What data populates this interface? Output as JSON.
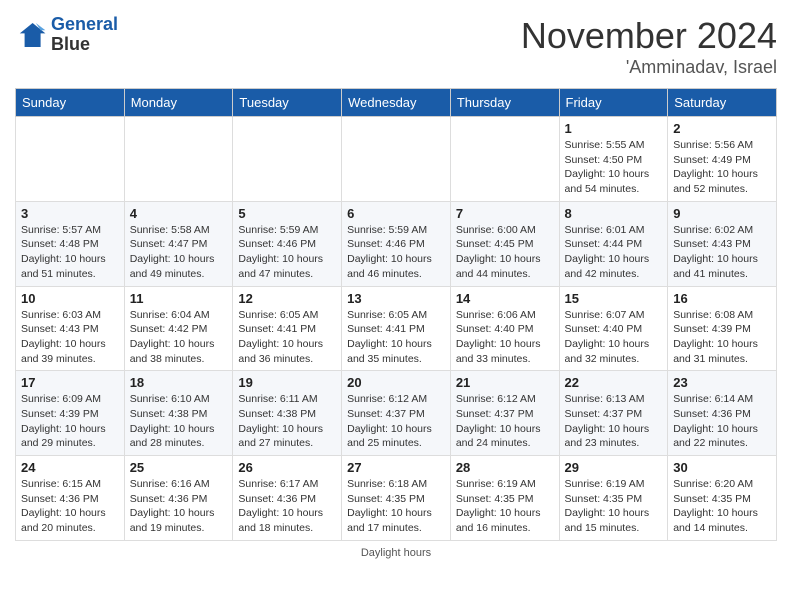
{
  "logo": {
    "line1": "General",
    "line2": "Blue"
  },
  "header": {
    "month": "November 2024",
    "location": "'Amminadav, Israel"
  },
  "weekdays": [
    "Sunday",
    "Monday",
    "Tuesday",
    "Wednesday",
    "Thursday",
    "Friday",
    "Saturday"
  ],
  "footer": {
    "daylight_label": "Daylight hours"
  },
  "weeks": [
    [
      {
        "day": "",
        "sunrise": "",
        "sunset": "",
        "daylight": ""
      },
      {
        "day": "",
        "sunrise": "",
        "sunset": "",
        "daylight": ""
      },
      {
        "day": "",
        "sunrise": "",
        "sunset": "",
        "daylight": ""
      },
      {
        "day": "",
        "sunrise": "",
        "sunset": "",
        "daylight": ""
      },
      {
        "day": "",
        "sunrise": "",
        "sunset": "",
        "daylight": ""
      },
      {
        "day": "1",
        "sunrise": "Sunrise: 5:55 AM",
        "sunset": "Sunset: 4:50 PM",
        "daylight": "Daylight: 10 hours and 54 minutes."
      },
      {
        "day": "2",
        "sunrise": "Sunrise: 5:56 AM",
        "sunset": "Sunset: 4:49 PM",
        "daylight": "Daylight: 10 hours and 52 minutes."
      }
    ],
    [
      {
        "day": "3",
        "sunrise": "Sunrise: 5:57 AM",
        "sunset": "Sunset: 4:48 PM",
        "daylight": "Daylight: 10 hours and 51 minutes."
      },
      {
        "day": "4",
        "sunrise": "Sunrise: 5:58 AM",
        "sunset": "Sunset: 4:47 PM",
        "daylight": "Daylight: 10 hours and 49 minutes."
      },
      {
        "day": "5",
        "sunrise": "Sunrise: 5:59 AM",
        "sunset": "Sunset: 4:46 PM",
        "daylight": "Daylight: 10 hours and 47 minutes."
      },
      {
        "day": "6",
        "sunrise": "Sunrise: 5:59 AM",
        "sunset": "Sunset: 4:46 PM",
        "daylight": "Daylight: 10 hours and 46 minutes."
      },
      {
        "day": "7",
        "sunrise": "Sunrise: 6:00 AM",
        "sunset": "Sunset: 4:45 PM",
        "daylight": "Daylight: 10 hours and 44 minutes."
      },
      {
        "day": "8",
        "sunrise": "Sunrise: 6:01 AM",
        "sunset": "Sunset: 4:44 PM",
        "daylight": "Daylight: 10 hours and 42 minutes."
      },
      {
        "day": "9",
        "sunrise": "Sunrise: 6:02 AM",
        "sunset": "Sunset: 4:43 PM",
        "daylight": "Daylight: 10 hours and 41 minutes."
      }
    ],
    [
      {
        "day": "10",
        "sunrise": "Sunrise: 6:03 AM",
        "sunset": "Sunset: 4:43 PM",
        "daylight": "Daylight: 10 hours and 39 minutes."
      },
      {
        "day": "11",
        "sunrise": "Sunrise: 6:04 AM",
        "sunset": "Sunset: 4:42 PM",
        "daylight": "Daylight: 10 hours and 38 minutes."
      },
      {
        "day": "12",
        "sunrise": "Sunrise: 6:05 AM",
        "sunset": "Sunset: 4:41 PM",
        "daylight": "Daylight: 10 hours and 36 minutes."
      },
      {
        "day": "13",
        "sunrise": "Sunrise: 6:05 AM",
        "sunset": "Sunset: 4:41 PM",
        "daylight": "Daylight: 10 hours and 35 minutes."
      },
      {
        "day": "14",
        "sunrise": "Sunrise: 6:06 AM",
        "sunset": "Sunset: 4:40 PM",
        "daylight": "Daylight: 10 hours and 33 minutes."
      },
      {
        "day": "15",
        "sunrise": "Sunrise: 6:07 AM",
        "sunset": "Sunset: 4:40 PM",
        "daylight": "Daylight: 10 hours and 32 minutes."
      },
      {
        "day": "16",
        "sunrise": "Sunrise: 6:08 AM",
        "sunset": "Sunset: 4:39 PM",
        "daylight": "Daylight: 10 hours and 31 minutes."
      }
    ],
    [
      {
        "day": "17",
        "sunrise": "Sunrise: 6:09 AM",
        "sunset": "Sunset: 4:39 PM",
        "daylight": "Daylight: 10 hours and 29 minutes."
      },
      {
        "day": "18",
        "sunrise": "Sunrise: 6:10 AM",
        "sunset": "Sunset: 4:38 PM",
        "daylight": "Daylight: 10 hours and 28 minutes."
      },
      {
        "day": "19",
        "sunrise": "Sunrise: 6:11 AM",
        "sunset": "Sunset: 4:38 PM",
        "daylight": "Daylight: 10 hours and 27 minutes."
      },
      {
        "day": "20",
        "sunrise": "Sunrise: 6:12 AM",
        "sunset": "Sunset: 4:37 PM",
        "daylight": "Daylight: 10 hours and 25 minutes."
      },
      {
        "day": "21",
        "sunrise": "Sunrise: 6:12 AM",
        "sunset": "Sunset: 4:37 PM",
        "daylight": "Daylight: 10 hours and 24 minutes."
      },
      {
        "day": "22",
        "sunrise": "Sunrise: 6:13 AM",
        "sunset": "Sunset: 4:37 PM",
        "daylight": "Daylight: 10 hours and 23 minutes."
      },
      {
        "day": "23",
        "sunrise": "Sunrise: 6:14 AM",
        "sunset": "Sunset: 4:36 PM",
        "daylight": "Daylight: 10 hours and 22 minutes."
      }
    ],
    [
      {
        "day": "24",
        "sunrise": "Sunrise: 6:15 AM",
        "sunset": "Sunset: 4:36 PM",
        "daylight": "Daylight: 10 hours and 20 minutes."
      },
      {
        "day": "25",
        "sunrise": "Sunrise: 6:16 AM",
        "sunset": "Sunset: 4:36 PM",
        "daylight": "Daylight: 10 hours and 19 minutes."
      },
      {
        "day": "26",
        "sunrise": "Sunrise: 6:17 AM",
        "sunset": "Sunset: 4:36 PM",
        "daylight": "Daylight: 10 hours and 18 minutes."
      },
      {
        "day": "27",
        "sunrise": "Sunrise: 6:18 AM",
        "sunset": "Sunset: 4:35 PM",
        "daylight": "Daylight: 10 hours and 17 minutes."
      },
      {
        "day": "28",
        "sunrise": "Sunrise: 6:19 AM",
        "sunset": "Sunset: 4:35 PM",
        "daylight": "Daylight: 10 hours and 16 minutes."
      },
      {
        "day": "29",
        "sunrise": "Sunrise: 6:19 AM",
        "sunset": "Sunset: 4:35 PM",
        "daylight": "Daylight: 10 hours and 15 minutes."
      },
      {
        "day": "30",
        "sunrise": "Sunrise: 6:20 AM",
        "sunset": "Sunset: 4:35 PM",
        "daylight": "Daylight: 10 hours and 14 minutes."
      }
    ]
  ]
}
